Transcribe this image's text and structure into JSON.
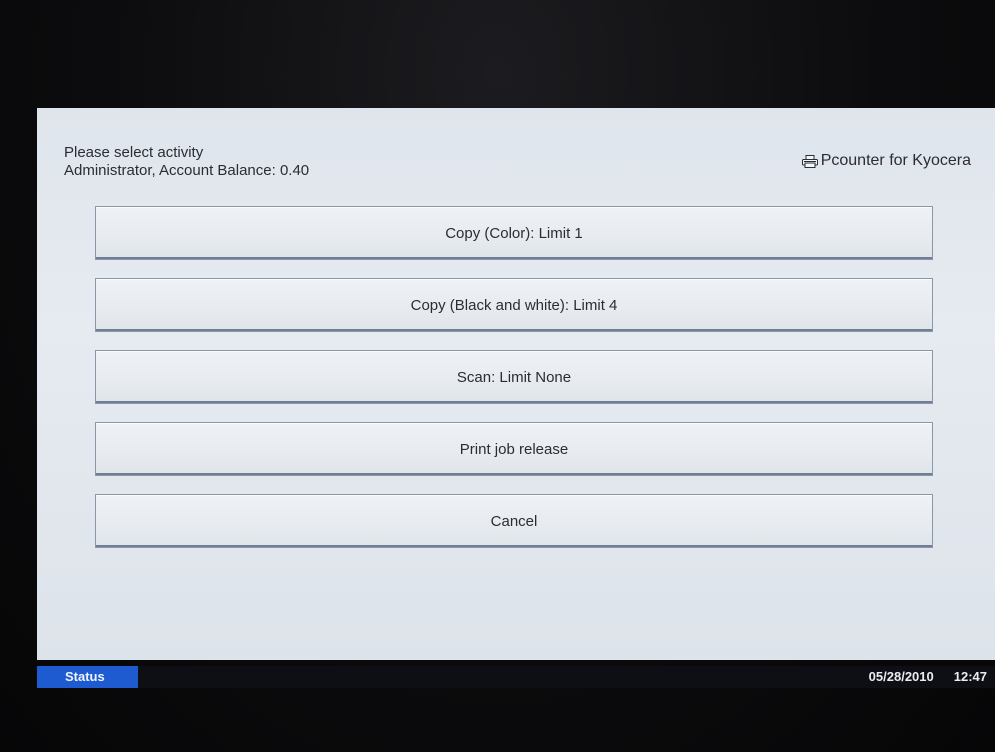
{
  "header": {
    "prompt": "Please select activity",
    "account_line": "Administrator, Account Balance: 0.40",
    "brand": "Pcounter for Kyocera",
    "brand_icon": "printer-icon"
  },
  "activities": [
    {
      "label": "Copy (Color):  Limit 1"
    },
    {
      "label": "Copy (Black and white):  Limit 4"
    },
    {
      "label": "Scan:  Limit None"
    },
    {
      "label": "Print job release"
    },
    {
      "label": "Cancel"
    }
  ],
  "statusbar": {
    "status_label": "Status",
    "date": "05/28/2010",
    "time": "12:47",
    "status_color": "#1f5bd0"
  }
}
